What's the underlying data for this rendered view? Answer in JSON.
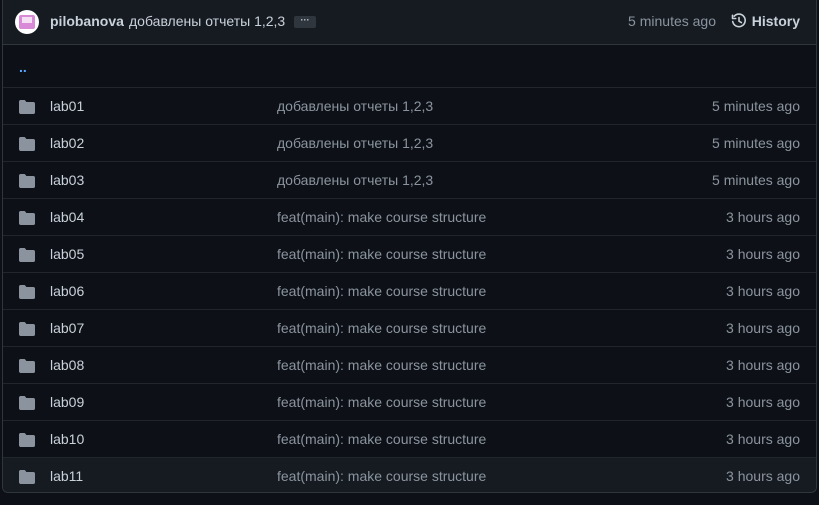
{
  "header": {
    "author": "pilobanova",
    "commit_message": "добавлены отчеты 1,2,3",
    "ellipsis": "···",
    "time": "5 minutes ago",
    "history_label": "History"
  },
  "parent_dir": "..",
  "rows": [
    {
      "name": "lab01",
      "message": "добавлены отчеты 1,2,3",
      "time": "5 minutes ago"
    },
    {
      "name": "lab02",
      "message": "добавлены отчеты 1,2,3",
      "time": "5 minutes ago"
    },
    {
      "name": "lab03",
      "message": "добавлены отчеты 1,2,3",
      "time": "5 minutes ago"
    },
    {
      "name": "lab04",
      "message": "feat(main): make course structure",
      "time": "3 hours ago"
    },
    {
      "name": "lab05",
      "message": "feat(main): make course structure",
      "time": "3 hours ago"
    },
    {
      "name": "lab06",
      "message": "feat(main): make course structure",
      "time": "3 hours ago"
    },
    {
      "name": "lab07",
      "message": "feat(main): make course structure",
      "time": "3 hours ago"
    },
    {
      "name": "lab08",
      "message": "feat(main): make course structure",
      "time": "3 hours ago"
    },
    {
      "name": "lab09",
      "message": "feat(main): make course structure",
      "time": "3 hours ago"
    },
    {
      "name": "lab10",
      "message": "feat(main): make course structure",
      "time": "3 hours ago"
    },
    {
      "name": "lab11",
      "message": "feat(main): make course structure",
      "time": "3 hours ago"
    }
  ],
  "colors": {
    "background": "#0d1117",
    "header_bg": "#161b22",
    "border": "#30363d",
    "text": "#c9d1d9",
    "muted": "#8b949e",
    "link": "#58a6ff",
    "folder_icon": "#8b949e"
  },
  "icons": {
    "folder": "folder-icon",
    "history": "history-icon",
    "avatar": "avatar"
  }
}
